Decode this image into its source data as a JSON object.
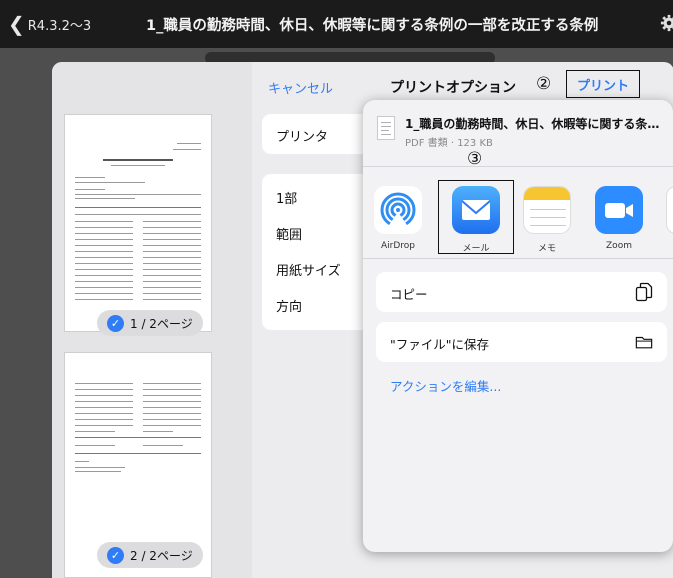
{
  "navbar": {
    "back_label": "R4.3.2〜3",
    "title": "1_職員の勤務時間、休日、休暇等に関する条例の一部を改正する条例"
  },
  "print_options": {
    "cancel_label": "キャンセル",
    "title": "プリントオプション",
    "print_label": "プリント",
    "step_marker": "②",
    "printer_label": "プリンタ",
    "copies_label": "1部",
    "range_label": "範囲",
    "paper_size_label": "用紙サイズ",
    "orientation_label": "方向"
  },
  "thumbnails": {
    "page1_label": "1 / 2ページ",
    "page2_label": "2 / 2ページ"
  },
  "share_sheet": {
    "doc_title": "1_職員の勤務時間、休日、休暇等に関する条…",
    "doc_subtitle": "PDF 書類 · 123 KB",
    "step_marker": "③",
    "apps": [
      {
        "label": "AirDrop",
        "icon": "airdrop-icon"
      },
      {
        "label": "メール",
        "icon": "mail-icon"
      },
      {
        "label": "メモ",
        "icon": "notes-icon"
      },
      {
        "label": "Zoom",
        "icon": "zoom-icon"
      }
    ],
    "copy_label": "コピー",
    "save_to_files_label": "\"ファイル\"に保存",
    "edit_actions_label": "アクションを編集..."
  },
  "colors": {
    "accent": "#2f7cf6",
    "navbar": "#1b1b1b"
  }
}
